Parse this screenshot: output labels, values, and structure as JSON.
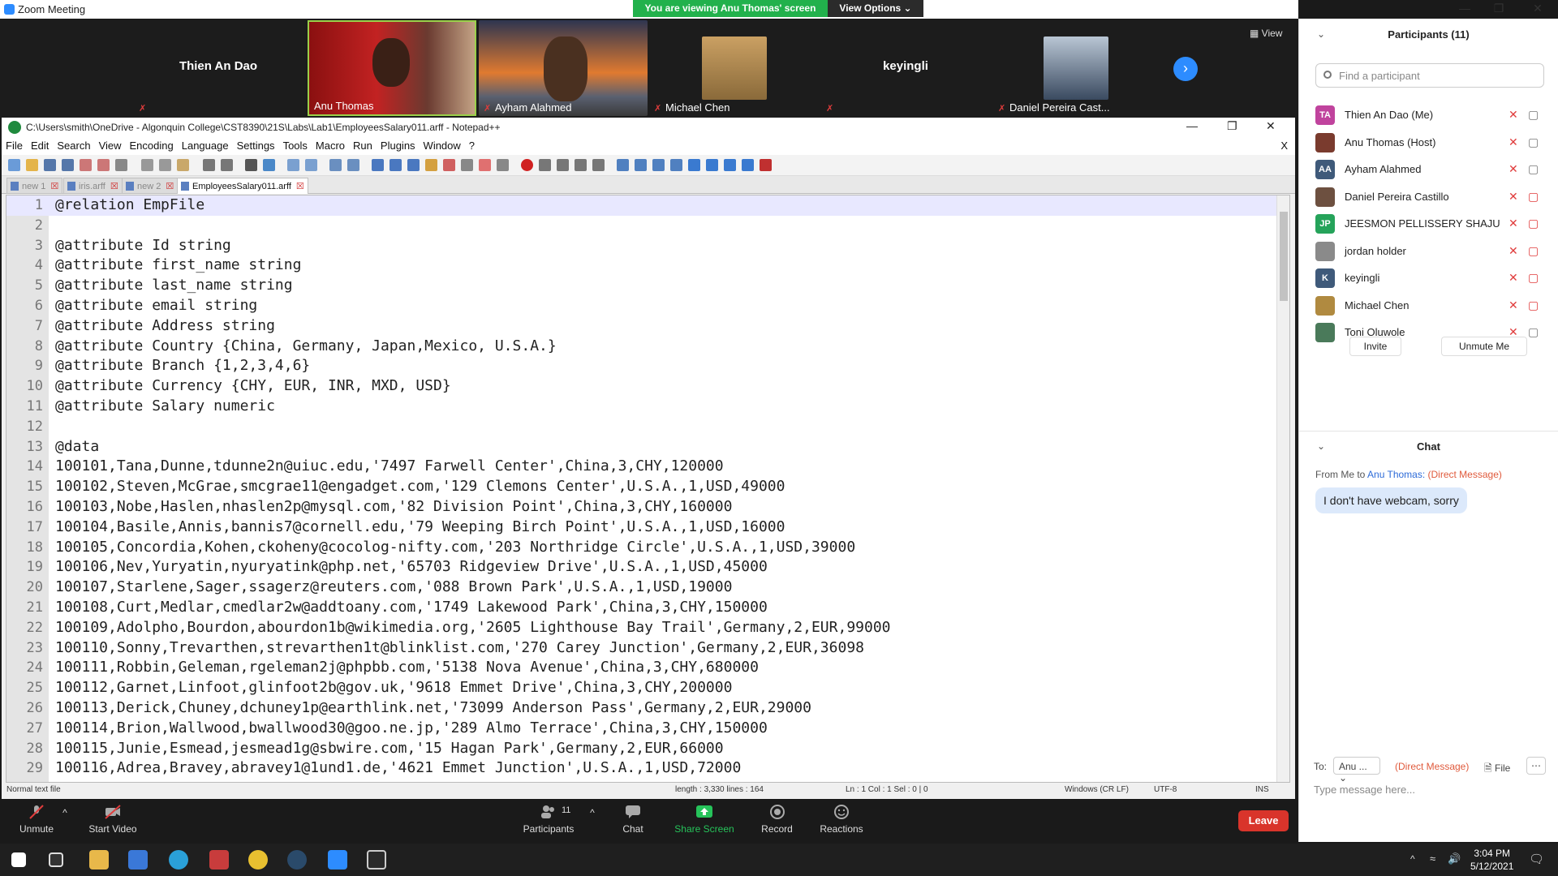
{
  "zoom": {
    "window_title": "Zoom Meeting",
    "share_banner": "You are viewing Anu Thomas' screen",
    "view_options": "View Options ⌄",
    "view_label": "View",
    "gallery": [
      {
        "name": "Thien An Dao",
        "video": false
      },
      {
        "name": "Anu Thomas",
        "video": true
      },
      {
        "name": "Ayham Alahmed",
        "video": true
      },
      {
        "name": "Michael Chen",
        "video": true
      },
      {
        "name": "keyingli",
        "video": false
      },
      {
        "name": "Daniel Pereira Cast...",
        "video": true
      }
    ],
    "toolbar": {
      "unmute": "Unmute",
      "start_video": "Start Video",
      "participants": "Participants",
      "participants_count": "11",
      "chat": "Chat",
      "share_screen": "Share Screen",
      "record": "Record",
      "reactions": "Reactions",
      "leave": "Leave"
    }
  },
  "notepad": {
    "title": "C:\\Users\\smith\\OneDrive - Algonquin College\\CST8390\\21S\\Labs\\Lab1\\EmployeesSalary011.arff - Notepad++",
    "menu": [
      "File",
      "Edit",
      "Search",
      "View",
      "Encoding",
      "Language",
      "Settings",
      "Tools",
      "Macro",
      "Run",
      "Plugins",
      "Window",
      "?"
    ],
    "tabs": [
      "new 1",
      "iris.arff",
      "new 2",
      "EmployeesSalary011.arff"
    ],
    "lines": [
      "@relation EmpFile",
      "",
      "@attribute Id string",
      "@attribute first_name string",
      "@attribute last_name string",
      "@attribute email string",
      "@attribute Address string",
      "@attribute Country {China, Germany, Japan,Mexico, U.S.A.}",
      "@attribute Branch {1,2,3,4,6}",
      "@attribute Currency {CHY, EUR, INR, MXD, USD}",
      "@attribute Salary numeric",
      "",
      "@data",
      "100101,Tana,Dunne,tdunne2n@uiuc.edu,'7497 Farwell Center',China,3,CHY,120000",
      "100102,Steven,McGrae,smcgrae11@engadget.com,'129 Clemons Center',U.S.A.,1,USD,49000",
      "100103,Nobe,Haslen,nhaslen2p@mysql.com,'82 Division Point',China,3,CHY,160000",
      "100104,Basile,Annis,bannis7@cornell.edu,'79 Weeping Birch Point',U.S.A.,1,USD,16000",
      "100105,Concordia,Kohen,ckoheny@cocolog-nifty.com,'203 Northridge Circle',U.S.A.,1,USD,39000",
      "100106,Nev,Yuryatin,nyuryatink@php.net,'65703 Ridgeview Drive',U.S.A.,1,USD,45000",
      "100107,Starlene,Sager,ssagerz@reuters.com,'088 Brown Park',U.S.A.,1,USD,19000",
      "100108,Curt,Medlar,cmedlar2w@addtoany.com,'1749 Lakewood Park',China,3,CHY,150000",
      "100109,Adolpho,Bourdon,abourdon1b@wikimedia.org,'2605 Lighthouse Bay Trail',Germany,2,EUR,99000",
      "100110,Sonny,Trevarthen,strevarthen1t@blinklist.com,'270 Carey Junction',Germany,2,EUR,36098",
      "100111,Robbin,Geleman,rgeleman2j@phpbb.com,'5138 Nova Avenue',China,3,CHY,680000",
      "100112,Garnet,Linfoot,glinfoot2b@gov.uk,'9618 Emmet Drive',China,3,CHY,200000",
      "100113,Derick,Chuney,dchuney1p@earthlink.net,'73099 Anderson Pass',Germany,2,EUR,29000",
      "100114,Brion,Wallwood,bwallwood30@goo.ne.jp,'289 Almo Terrace',China,3,CHY,150000",
      "100115,Junie,Esmead,jesmead1g@sbwire.com,'15 Hagan Park',Germany,2,EUR,66000",
      "100116,Adrea,Bravey,abravey1@1und1.de,'4621 Emmet Junction',U.S.A.,1,USD,72000"
    ],
    "status": {
      "type": "Normal text file",
      "length": "length : 3,330    lines : 164",
      "pos": "Ln : 1    Col : 1    Sel : 0 | 0",
      "eol": "Windows (CR LF)",
      "enc": "UTF-8",
      "mode": "INS"
    }
  },
  "panel": {
    "participants_title": "Participants (11)",
    "search_placeholder": "Find a participant",
    "participants": [
      {
        "initials": "TA",
        "name": "Thien An Dao (Me)",
        "color": "#c0439d",
        "video_on": true
      },
      {
        "initials": "",
        "name": "Anu Thomas (Host)",
        "color": "#7a3b2e",
        "video_on": true
      },
      {
        "initials": "AA",
        "name": "Ayham Alahmed",
        "color": "#3f5a7a",
        "video_on": true
      },
      {
        "initials": "",
        "name": "Daniel Pereira Castillo",
        "color": "#6d5040",
        "video_on": false
      },
      {
        "initials": "JP",
        "name": "JEESMON PELLISSERY SHAJU",
        "color": "#25a35a",
        "video_on": false
      },
      {
        "initials": "",
        "name": "jordan holder",
        "color": "#8a8a8a",
        "video_on": false
      },
      {
        "initials": "K",
        "name": "keyingli",
        "color": "#3f5a7a",
        "video_on": false
      },
      {
        "initials": "",
        "name": "Michael Chen",
        "color": "#b08a40",
        "video_on": false
      },
      {
        "initials": "",
        "name": "Toni Oluwole",
        "color": "#4a7a5a",
        "video_on": true
      }
    ],
    "invite": "Invite",
    "unmute_me": "Unmute Me",
    "chat_title": "Chat",
    "chat_from": "From Me to",
    "chat_to_name": "Anu Thomas:",
    "chat_dm": "(Direct Message)",
    "chat_message": "I don't have webcam, sorry",
    "to_label": "To:",
    "to_value": "Anu ...",
    "to_dm": "(Direct Message)",
    "file": "File",
    "input_placeholder": "Type message here..."
  },
  "taskbar": {
    "time": "3:04 PM",
    "date": "5/12/2021"
  }
}
